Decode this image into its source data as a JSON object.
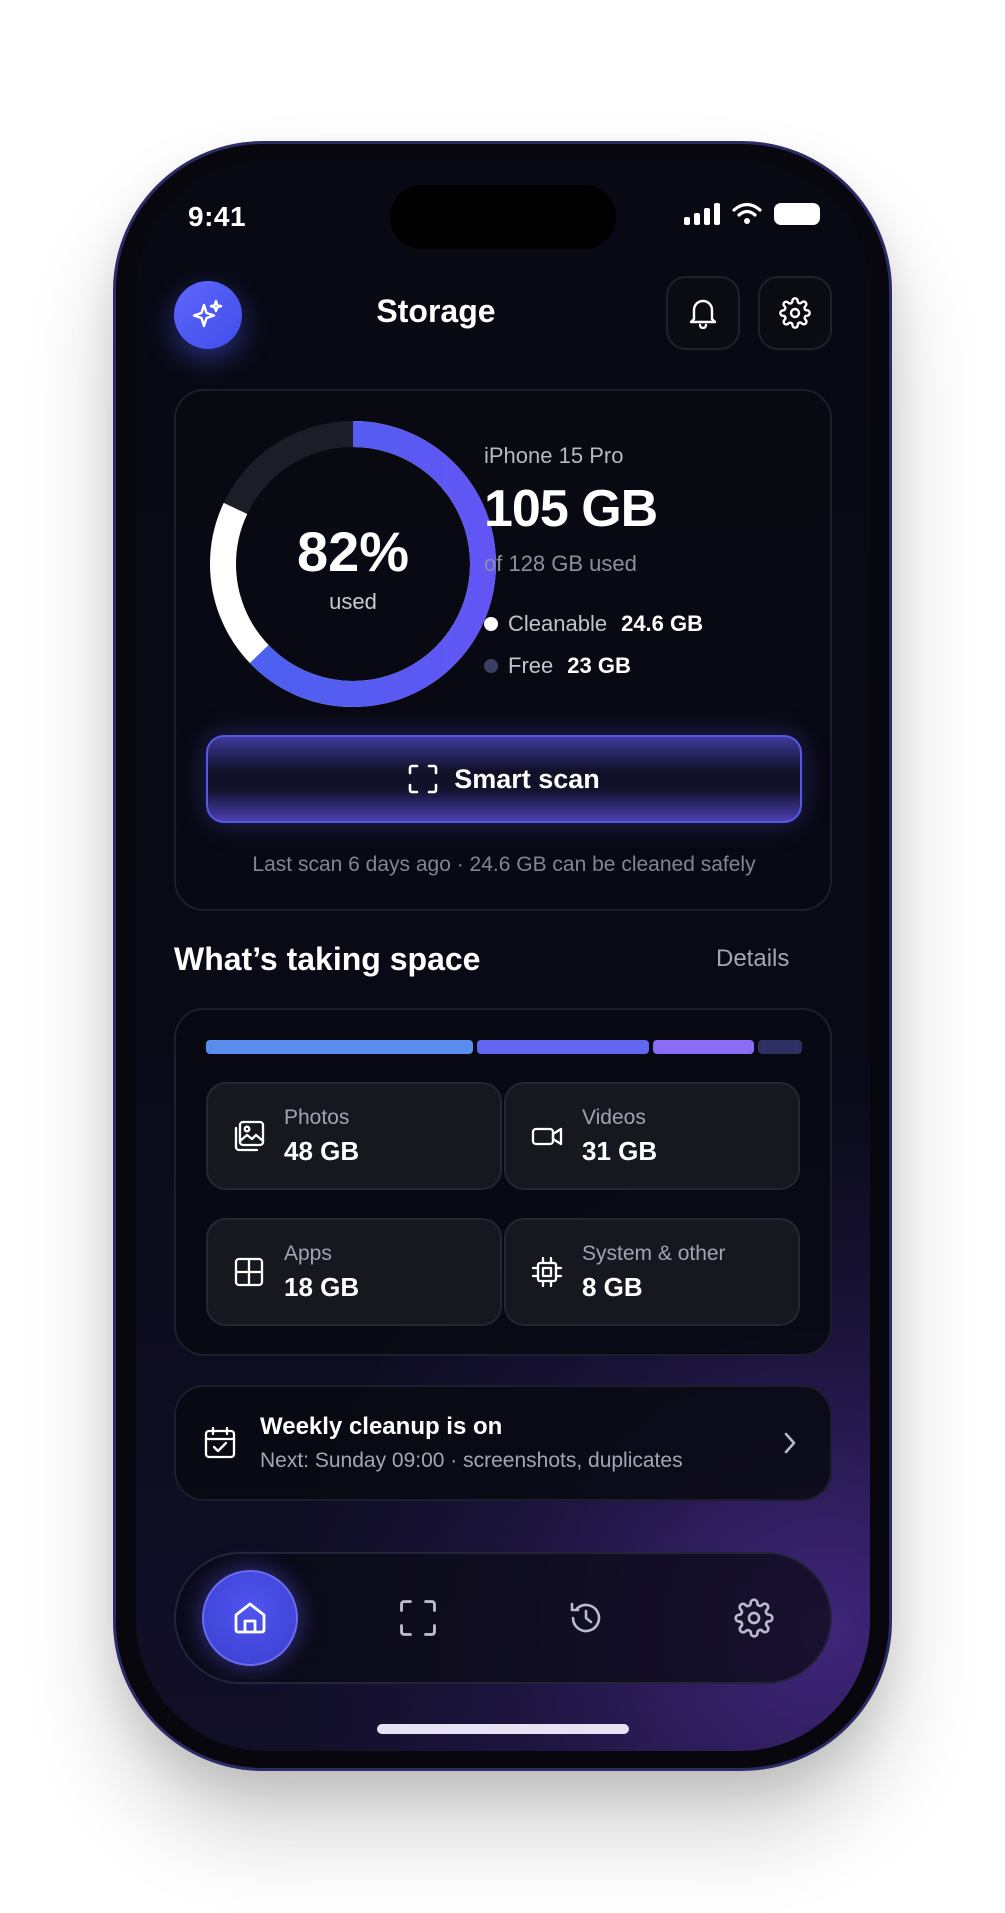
{
  "status_bar": {
    "time": "9:41"
  },
  "header": {
    "title": "Storage"
  },
  "storage": {
    "percent_label": "82%",
    "used_label": "used",
    "device": "iPhone 15 Pro",
    "used_amount": "105 GB",
    "total_label": "of 128 GB used",
    "cleanable_label": "Cleanable",
    "cleanable_value": "24.6 GB",
    "free_label": "Free",
    "free_value": "23 GB",
    "ring": {
      "used_fraction": 0.82,
      "cleanable_fraction": 0.192,
      "free_fraction": 0.18
    },
    "scan_button": "Smart scan",
    "last_scan": "Last scan 6 days ago · 24.6 GB can be cleaned safely"
  },
  "space": {
    "title": "What’s taking space",
    "details_link": "Details",
    "bar_segments": [
      {
        "label": "Photos",
        "gb": 48,
        "color": "#5b8def"
      },
      {
        "label": "Videos",
        "gb": 31,
        "color": "#6366f1"
      },
      {
        "label": "Apps",
        "gb": 18,
        "color": "#8b6cf6"
      },
      {
        "label": "System & other",
        "gb": 8,
        "color": "#2e2f63"
      }
    ],
    "tiles": [
      {
        "label": "Photos",
        "value": "48 GB",
        "icon": "photos-icon"
      },
      {
        "label": "Videos",
        "value": "31 GB",
        "icon": "video-camera-icon"
      },
      {
        "label": "Apps",
        "value": "18 GB",
        "icon": "apps-grid-icon"
      },
      {
        "label": "System & other",
        "value": "8 GB",
        "icon": "chip-icon"
      }
    ]
  },
  "weekly": {
    "title": "Weekly cleanup is on",
    "subtitle": "Next: Sunday 09:00 · screenshots, duplicates"
  },
  "tabbar": {
    "active": "home",
    "items": [
      "home-icon",
      "scan-icon",
      "history-icon",
      "settings-icon"
    ]
  },
  "colors": {
    "accent": "#4f57f0",
    "ring_used": "#5b5cf2",
    "ring_cleanable": "#ffffff",
    "ring_free": "#1c1d26"
  }
}
